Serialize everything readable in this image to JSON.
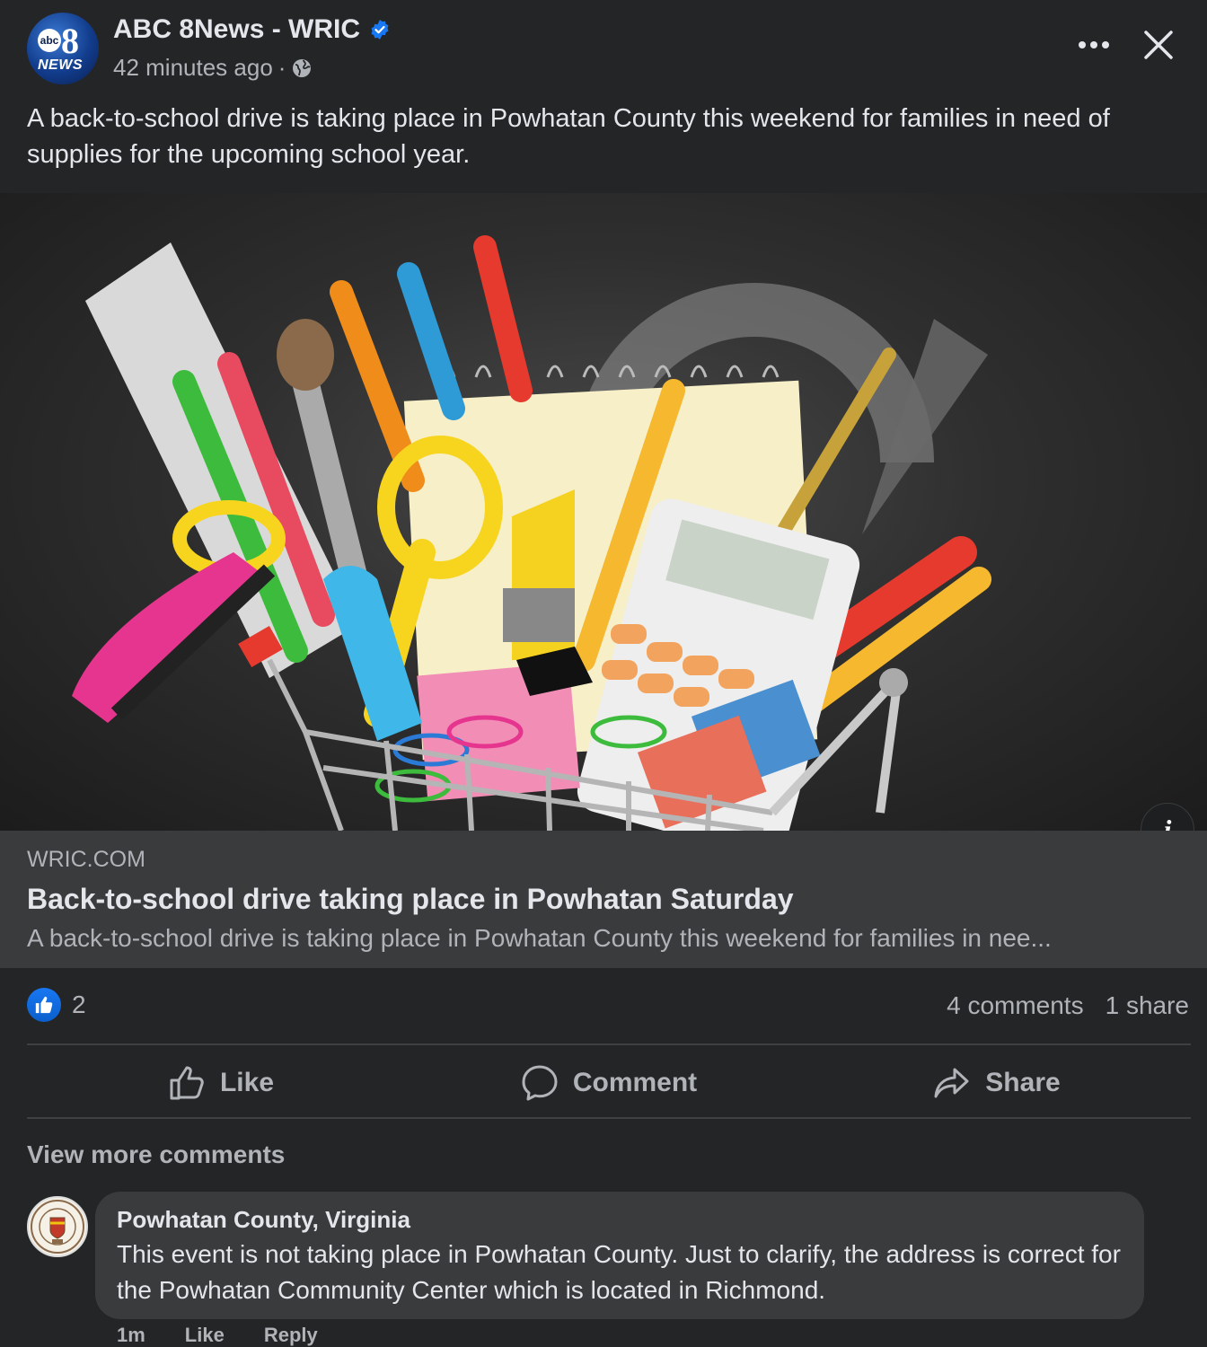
{
  "post": {
    "page_name": "ABC 8News - WRIC",
    "avatar_logo": {
      "abc": "abc",
      "number": "8",
      "news": "NEWS"
    },
    "time": "42 minutes ago",
    "separator": "·",
    "text": "A back-to-school drive is taking place in Powhatan County this weekend for families in need of supplies for the upcoming school year."
  },
  "link_preview": {
    "domain": "WRIC.COM",
    "title": "Back-to-school drive taking place in Powhatan Saturday",
    "description": "A back-to-school drive is taking place in Powhatan County this weekend for families in nee..."
  },
  "engagement": {
    "reaction_count": "2",
    "comments": "4 comments",
    "shares": "1 share"
  },
  "actions": {
    "like": "Like",
    "comment": "Comment",
    "share": "Share"
  },
  "view_more": "View more comments",
  "comment": {
    "author": "Powhatan County, Virginia",
    "text": "This event is not taking place in Powhatan County. Just to clarify, the address is correct for the Powhatan Community Center which is located in Richmond.",
    "time": "1m",
    "like_label": "Like",
    "reply_label": "Reply"
  },
  "colors": {
    "background": "#242526",
    "card": "#3a3b3c",
    "primary_text": "#e4e6eb",
    "secondary_text": "#b0b3b8",
    "accent_blue": "#1877f2"
  },
  "icons": [
    "verified-badge-icon",
    "globe-icon",
    "more-options-icon",
    "close-icon",
    "info-icon",
    "like-reaction-icon",
    "thumbs-up-icon",
    "comment-icon",
    "share-icon"
  ]
}
